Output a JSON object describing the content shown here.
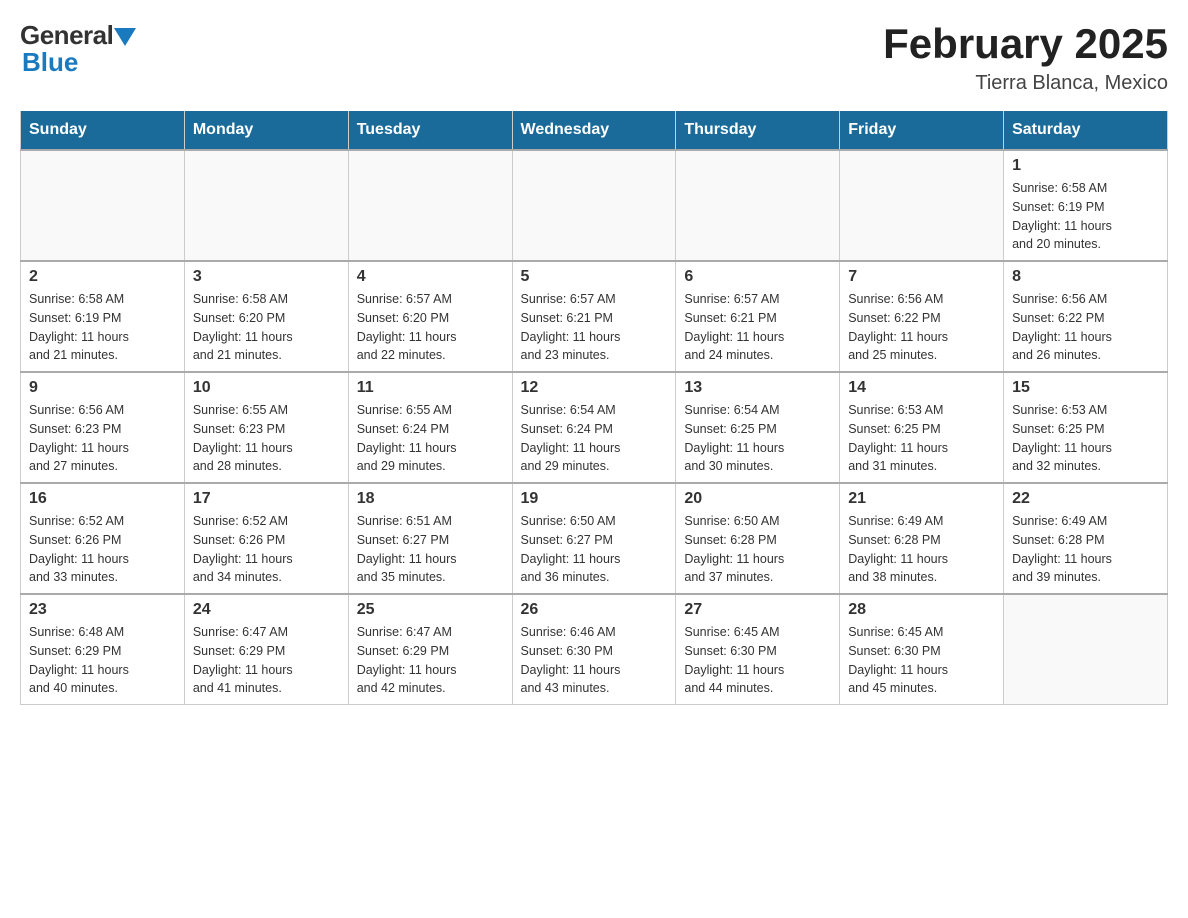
{
  "header": {
    "logo_general": "General",
    "logo_blue": "Blue",
    "title": "February 2025",
    "subtitle": "Tierra Blanca, Mexico"
  },
  "days_of_week": [
    "Sunday",
    "Monday",
    "Tuesday",
    "Wednesday",
    "Thursday",
    "Friday",
    "Saturday"
  ],
  "weeks": [
    [
      {
        "day": "",
        "info": ""
      },
      {
        "day": "",
        "info": ""
      },
      {
        "day": "",
        "info": ""
      },
      {
        "day": "",
        "info": ""
      },
      {
        "day": "",
        "info": ""
      },
      {
        "day": "",
        "info": ""
      },
      {
        "day": "1",
        "info": "Sunrise: 6:58 AM\nSunset: 6:19 PM\nDaylight: 11 hours\nand 20 minutes."
      }
    ],
    [
      {
        "day": "2",
        "info": "Sunrise: 6:58 AM\nSunset: 6:19 PM\nDaylight: 11 hours\nand 21 minutes."
      },
      {
        "day": "3",
        "info": "Sunrise: 6:58 AM\nSunset: 6:20 PM\nDaylight: 11 hours\nand 21 minutes."
      },
      {
        "day": "4",
        "info": "Sunrise: 6:57 AM\nSunset: 6:20 PM\nDaylight: 11 hours\nand 22 minutes."
      },
      {
        "day": "5",
        "info": "Sunrise: 6:57 AM\nSunset: 6:21 PM\nDaylight: 11 hours\nand 23 minutes."
      },
      {
        "day": "6",
        "info": "Sunrise: 6:57 AM\nSunset: 6:21 PM\nDaylight: 11 hours\nand 24 minutes."
      },
      {
        "day": "7",
        "info": "Sunrise: 6:56 AM\nSunset: 6:22 PM\nDaylight: 11 hours\nand 25 minutes."
      },
      {
        "day": "8",
        "info": "Sunrise: 6:56 AM\nSunset: 6:22 PM\nDaylight: 11 hours\nand 26 minutes."
      }
    ],
    [
      {
        "day": "9",
        "info": "Sunrise: 6:56 AM\nSunset: 6:23 PM\nDaylight: 11 hours\nand 27 minutes."
      },
      {
        "day": "10",
        "info": "Sunrise: 6:55 AM\nSunset: 6:23 PM\nDaylight: 11 hours\nand 28 minutes."
      },
      {
        "day": "11",
        "info": "Sunrise: 6:55 AM\nSunset: 6:24 PM\nDaylight: 11 hours\nand 29 minutes."
      },
      {
        "day": "12",
        "info": "Sunrise: 6:54 AM\nSunset: 6:24 PM\nDaylight: 11 hours\nand 29 minutes."
      },
      {
        "day": "13",
        "info": "Sunrise: 6:54 AM\nSunset: 6:25 PM\nDaylight: 11 hours\nand 30 minutes."
      },
      {
        "day": "14",
        "info": "Sunrise: 6:53 AM\nSunset: 6:25 PM\nDaylight: 11 hours\nand 31 minutes."
      },
      {
        "day": "15",
        "info": "Sunrise: 6:53 AM\nSunset: 6:25 PM\nDaylight: 11 hours\nand 32 minutes."
      }
    ],
    [
      {
        "day": "16",
        "info": "Sunrise: 6:52 AM\nSunset: 6:26 PM\nDaylight: 11 hours\nand 33 minutes."
      },
      {
        "day": "17",
        "info": "Sunrise: 6:52 AM\nSunset: 6:26 PM\nDaylight: 11 hours\nand 34 minutes."
      },
      {
        "day": "18",
        "info": "Sunrise: 6:51 AM\nSunset: 6:27 PM\nDaylight: 11 hours\nand 35 minutes."
      },
      {
        "day": "19",
        "info": "Sunrise: 6:50 AM\nSunset: 6:27 PM\nDaylight: 11 hours\nand 36 minutes."
      },
      {
        "day": "20",
        "info": "Sunrise: 6:50 AM\nSunset: 6:28 PM\nDaylight: 11 hours\nand 37 minutes."
      },
      {
        "day": "21",
        "info": "Sunrise: 6:49 AM\nSunset: 6:28 PM\nDaylight: 11 hours\nand 38 minutes."
      },
      {
        "day": "22",
        "info": "Sunrise: 6:49 AM\nSunset: 6:28 PM\nDaylight: 11 hours\nand 39 minutes."
      }
    ],
    [
      {
        "day": "23",
        "info": "Sunrise: 6:48 AM\nSunset: 6:29 PM\nDaylight: 11 hours\nand 40 minutes."
      },
      {
        "day": "24",
        "info": "Sunrise: 6:47 AM\nSunset: 6:29 PM\nDaylight: 11 hours\nand 41 minutes."
      },
      {
        "day": "25",
        "info": "Sunrise: 6:47 AM\nSunset: 6:29 PM\nDaylight: 11 hours\nand 42 minutes."
      },
      {
        "day": "26",
        "info": "Sunrise: 6:46 AM\nSunset: 6:30 PM\nDaylight: 11 hours\nand 43 minutes."
      },
      {
        "day": "27",
        "info": "Sunrise: 6:45 AM\nSunset: 6:30 PM\nDaylight: 11 hours\nand 44 minutes."
      },
      {
        "day": "28",
        "info": "Sunrise: 6:45 AM\nSunset: 6:30 PM\nDaylight: 11 hours\nand 45 minutes."
      },
      {
        "day": "",
        "info": ""
      }
    ]
  ]
}
